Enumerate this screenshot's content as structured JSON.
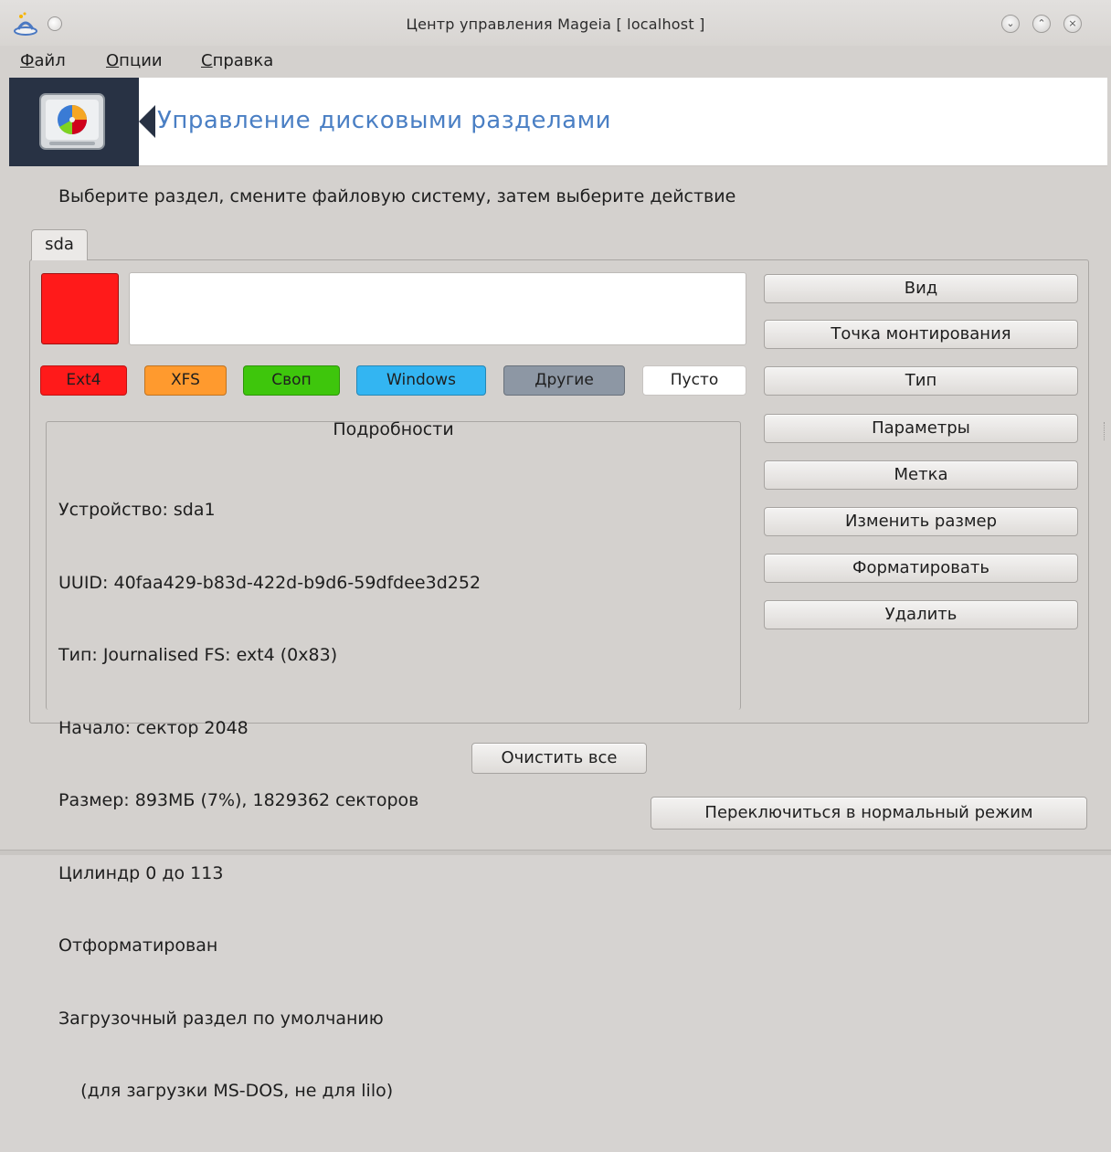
{
  "window": {
    "title": "Центр управления Mageia  [ localhost ]"
  },
  "menu": [
    {
      "underline": "Ф",
      "rest": "айл"
    },
    {
      "underline": "О",
      "rest": "пции"
    },
    {
      "underline": "С",
      "rest": "правка"
    }
  ],
  "banner": {
    "heading": "Управление дисковыми разделами"
  },
  "instruction": "Выберите раздел, смените файловую систему, затем выберите действие",
  "tab": {
    "label": "sda"
  },
  "legend": [
    {
      "label": "Ext4",
      "color": "#ff1a1a"
    },
    {
      "label": "XFS",
      "color": "#ff9a2e"
    },
    {
      "label": "Своп",
      "color": "#3ec60c"
    },
    {
      "label": "Windows",
      "color": "#33b5f2"
    },
    {
      "label": "Другие",
      "color": "#8d97a4"
    },
    {
      "label": "Пусто",
      "color": "#ffffff"
    }
  ],
  "details": {
    "title": "Подробности",
    "lines": [
      "Устройство: sda1",
      "UUID: 40faa429-b83d-422d-b9d6-59dfdee3d252",
      "Тип: Journalised FS: ext4 (0x83)",
      "Начало: сектор 2048",
      "Размер: 893МБ (7%), 1829362 секторов",
      "Цилиндр 0 до 113",
      "Отформатирован",
      "Загрузочный раздел по умолчанию",
      "    (для загрузки MS-DOS, не для lilo)"
    ]
  },
  "actions": [
    "Вид",
    "Точка монтирования",
    "Тип",
    "Параметры",
    "Метка",
    "Изменить размер",
    "Форматировать",
    "Удалить"
  ],
  "bottom": {
    "clear_all": "Очистить все",
    "normal_mode": "Переключиться в нормальный режим"
  },
  "colors": {
    "banner_dark": "#283244",
    "heading": "#4a7fc4",
    "selected_partition": "#ff1a1a"
  }
}
